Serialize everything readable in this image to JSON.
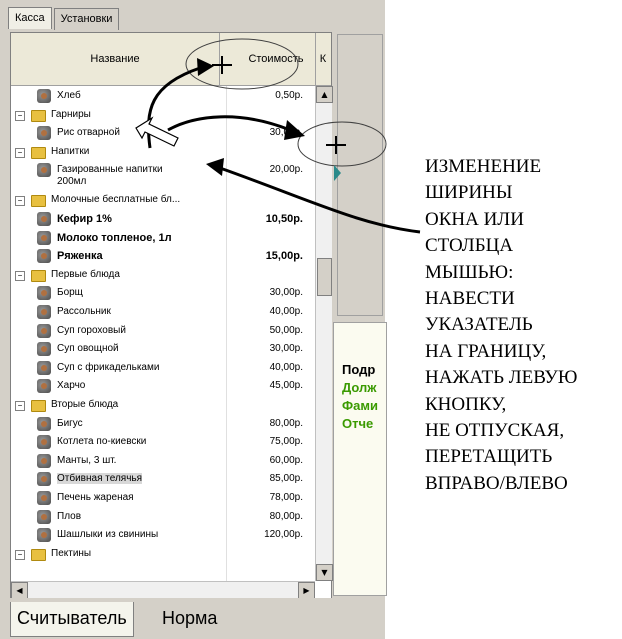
{
  "tabs": [
    "Касса",
    "Установки"
  ],
  "columns": {
    "name": "Название",
    "price": "Стоимость",
    "third": "К"
  },
  "rows": [
    {
      "level": 2,
      "type": "item",
      "label": "Хлеб",
      "price": "0,50р."
    },
    {
      "level": 1,
      "type": "group",
      "label": "Гарниры"
    },
    {
      "level": 2,
      "type": "item",
      "label": "Рис отварной",
      "price": "30,00р."
    },
    {
      "level": 1,
      "type": "group",
      "label": "Напитки"
    },
    {
      "level": 2,
      "type": "item2",
      "label": "Газированные напитки",
      "label2": "200мл",
      "price": "20,00р."
    },
    {
      "level": 1,
      "type": "group",
      "label": "Молочные бесплатные бл..."
    },
    {
      "level": 2,
      "type": "item",
      "label": "Кефир 1%",
      "price": "10,50р.",
      "bold": true
    },
    {
      "level": 2,
      "type": "item",
      "label": "Молоко топленое, 1л",
      "price": "",
      "bold": true
    },
    {
      "level": 2,
      "type": "item",
      "label": "Ряженка",
      "price": "15,00р.",
      "bold": true
    },
    {
      "level": 1,
      "type": "group",
      "label": "Первые блюда"
    },
    {
      "level": 2,
      "type": "item",
      "label": "Борщ",
      "price": "30,00р."
    },
    {
      "level": 2,
      "type": "item",
      "label": "Рассольник",
      "price": "40,00р."
    },
    {
      "level": 2,
      "type": "item",
      "label": "Суп гороховый",
      "price": "50,00р."
    },
    {
      "level": 2,
      "type": "item",
      "label": "Суп овощной",
      "price": "30,00р."
    },
    {
      "level": 2,
      "type": "item",
      "label": "Суп с фрикадельками",
      "price": "40,00р."
    },
    {
      "level": 2,
      "type": "item",
      "label": "Харчо",
      "price": "45,00р."
    },
    {
      "level": 1,
      "type": "group",
      "label": "Вторые блюда"
    },
    {
      "level": 2,
      "type": "item",
      "label": "Бигус",
      "price": "80,00р."
    },
    {
      "level": 2,
      "type": "item",
      "label": "Котлета по-киевски",
      "price": "75,00р."
    },
    {
      "level": 2,
      "type": "item",
      "label": "Манты, 3 шт.",
      "price": "60,00р."
    },
    {
      "level": 2,
      "type": "item",
      "label": "Отбивная телячья",
      "price": "85,00р.",
      "selected": true
    },
    {
      "level": 2,
      "type": "item",
      "label": "Печень жареная",
      "price": "78,00р."
    },
    {
      "level": 2,
      "type": "item",
      "label": "Плов",
      "price": "80,00р."
    },
    {
      "level": 2,
      "type": "item",
      "label": "Шашлыки из свинины",
      "price": "120,00р."
    },
    {
      "level": 1,
      "type": "group",
      "label": "Пектины"
    }
  ],
  "right_panel": {
    "lines": [
      "Подр",
      "Долж",
      "Фами",
      "Отче"
    ]
  },
  "bottom_tabs": [
    "Считыватель",
    "Норма"
  ],
  "annotation": {
    "lines": [
      "ИЗМЕНЕНИЕ",
      "ШИРИНЫ",
      "ОКНА ИЛИ",
      "СТОЛБЦА",
      "МЫШЬЮ:",
      "НАВЕСТИ",
      "УКАЗАТЕЛЬ",
      "НА ГРАНИЦУ,",
      "НАЖАТЬ ЛЕВУЮ",
      "КНОПКУ,",
      "НЕ ОТПУСКАЯ,",
      "ПЕРЕТАЩИТЬ",
      "ВПРАВО/ВЛЕВО"
    ]
  },
  "colors": {
    "green_text": "#3a9a00",
    "folder": "#e8c040",
    "header_bg": "#ece9d8"
  }
}
